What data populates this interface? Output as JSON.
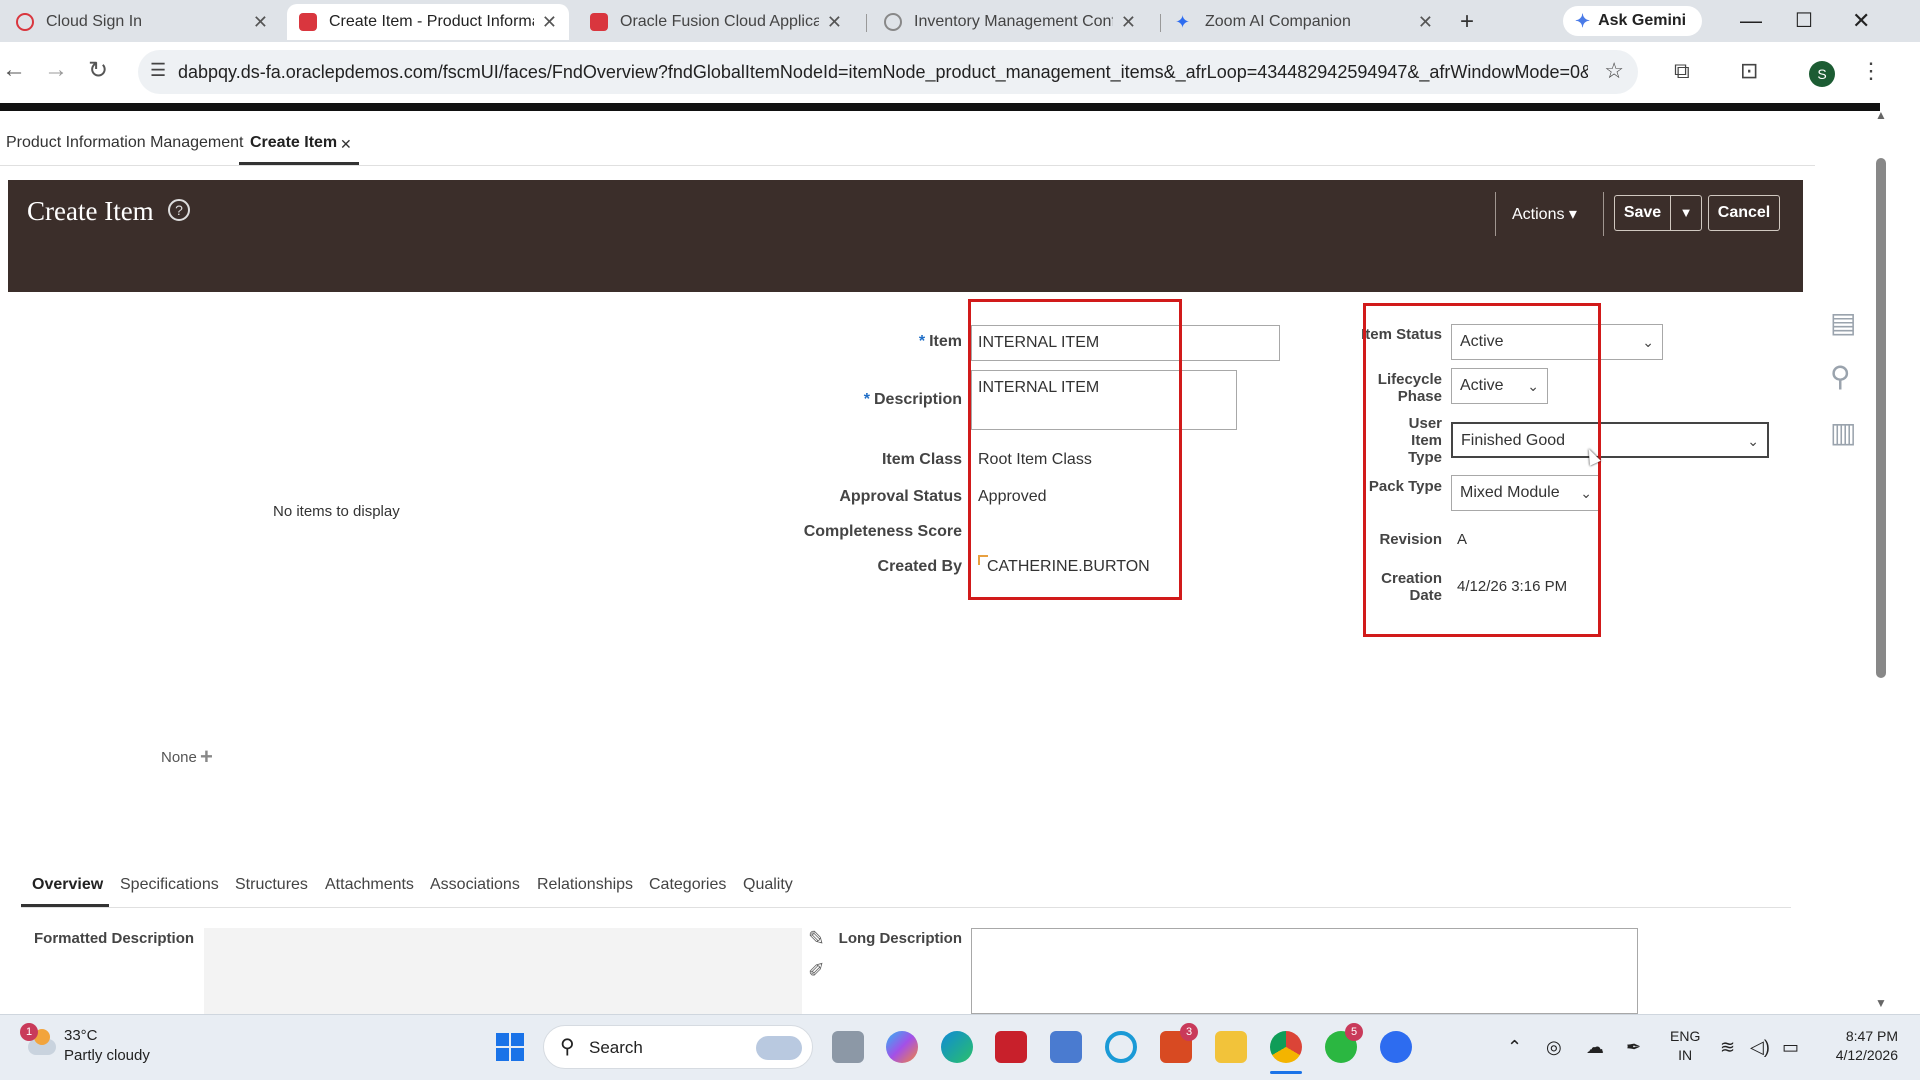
{
  "browser": {
    "tabs": [
      {
        "title": "Cloud Sign In",
        "active": false,
        "favicon_color": "#d9363e"
      },
      {
        "title": "Create Item - Product Informa",
        "active": true,
        "favicon_color": "#d9363e"
      },
      {
        "title": "Oracle Fusion Cloud Applicatio",
        "active": false,
        "favicon_color": "#d9363e"
      },
      {
        "title": "Inventory Management Config",
        "active": false,
        "favicon_color": "#888888"
      },
      {
        "title": "Zoom AI Companion",
        "active": false,
        "favicon_color": "#2d6cf0"
      }
    ],
    "new_tab_icon": "plus",
    "gemini_label": "Ask Gemini",
    "url": "dabpqy.ds-fa.oraclepdemos.com/fscmUI/faces/FndOverview?fndGlobalItemNodeId=itemNode_product_management_items&_afrLoop=434482942594947&_afrWindowMode=0&_afr...",
    "profile_initial": "S"
  },
  "app": {
    "tabs": [
      {
        "label": "Product Information Management",
        "active": false
      },
      {
        "label": "Create Item",
        "active": true
      }
    ],
    "header": {
      "title": "Create Item",
      "help_icon": "?",
      "actions_label": "Actions",
      "save_label": "Save",
      "cancel_label": "Cancel",
      "brand_color": "#3b2e2a"
    },
    "left_panel": {
      "empty_text": "No items to display",
      "none_label": "None"
    },
    "form": {
      "item_label": "Item",
      "item_value": "INTERNAL ITEM",
      "description_label": "Description",
      "description_value": "INTERNAL ITEM",
      "item_class_label": "Item Class",
      "item_class_value": "Root Item Class",
      "approval_status_label": "Approval Status",
      "approval_status_value": "Approved",
      "completeness_label": "Completeness Score",
      "completeness_value": "",
      "created_by_label": "Created By",
      "created_by_value": "CATHERINE.BURTON"
    },
    "attributes": {
      "item_status_label": "Item Status",
      "item_status_value": "Active",
      "lifecycle_label": "Lifecycle Phase",
      "lifecycle_value": "Active",
      "user_item_type_label": "User Item Type",
      "user_item_type_value": "Finished Good",
      "pack_type_label": "Pack Type",
      "pack_type_value": "Mixed Module",
      "revision_label": "Revision",
      "revision_value": "A",
      "creation_date_label": "Creation Date",
      "creation_date_value": "4/12/26 3:16 PM"
    },
    "subtabs": [
      "Overview",
      "Specifications",
      "Structures",
      "Attachments",
      "Associations",
      "Relationships",
      "Categories",
      "Quality"
    ],
    "overview": {
      "formatted_description_label": "Formatted Description",
      "long_description_label": "Long Description",
      "long_description_value": ""
    },
    "highlight_color": "#d11a1a"
  },
  "taskbar": {
    "weather_badge": "1",
    "temperature": "33°C",
    "weather_desc": "Partly cloudy",
    "search_label": "Search",
    "lang_top": "ENG",
    "lang_bottom": "IN",
    "time": "8:47 PM",
    "date": "4/12/2026",
    "badges": {
      "office": "3",
      "whatsapp": "5"
    }
  }
}
